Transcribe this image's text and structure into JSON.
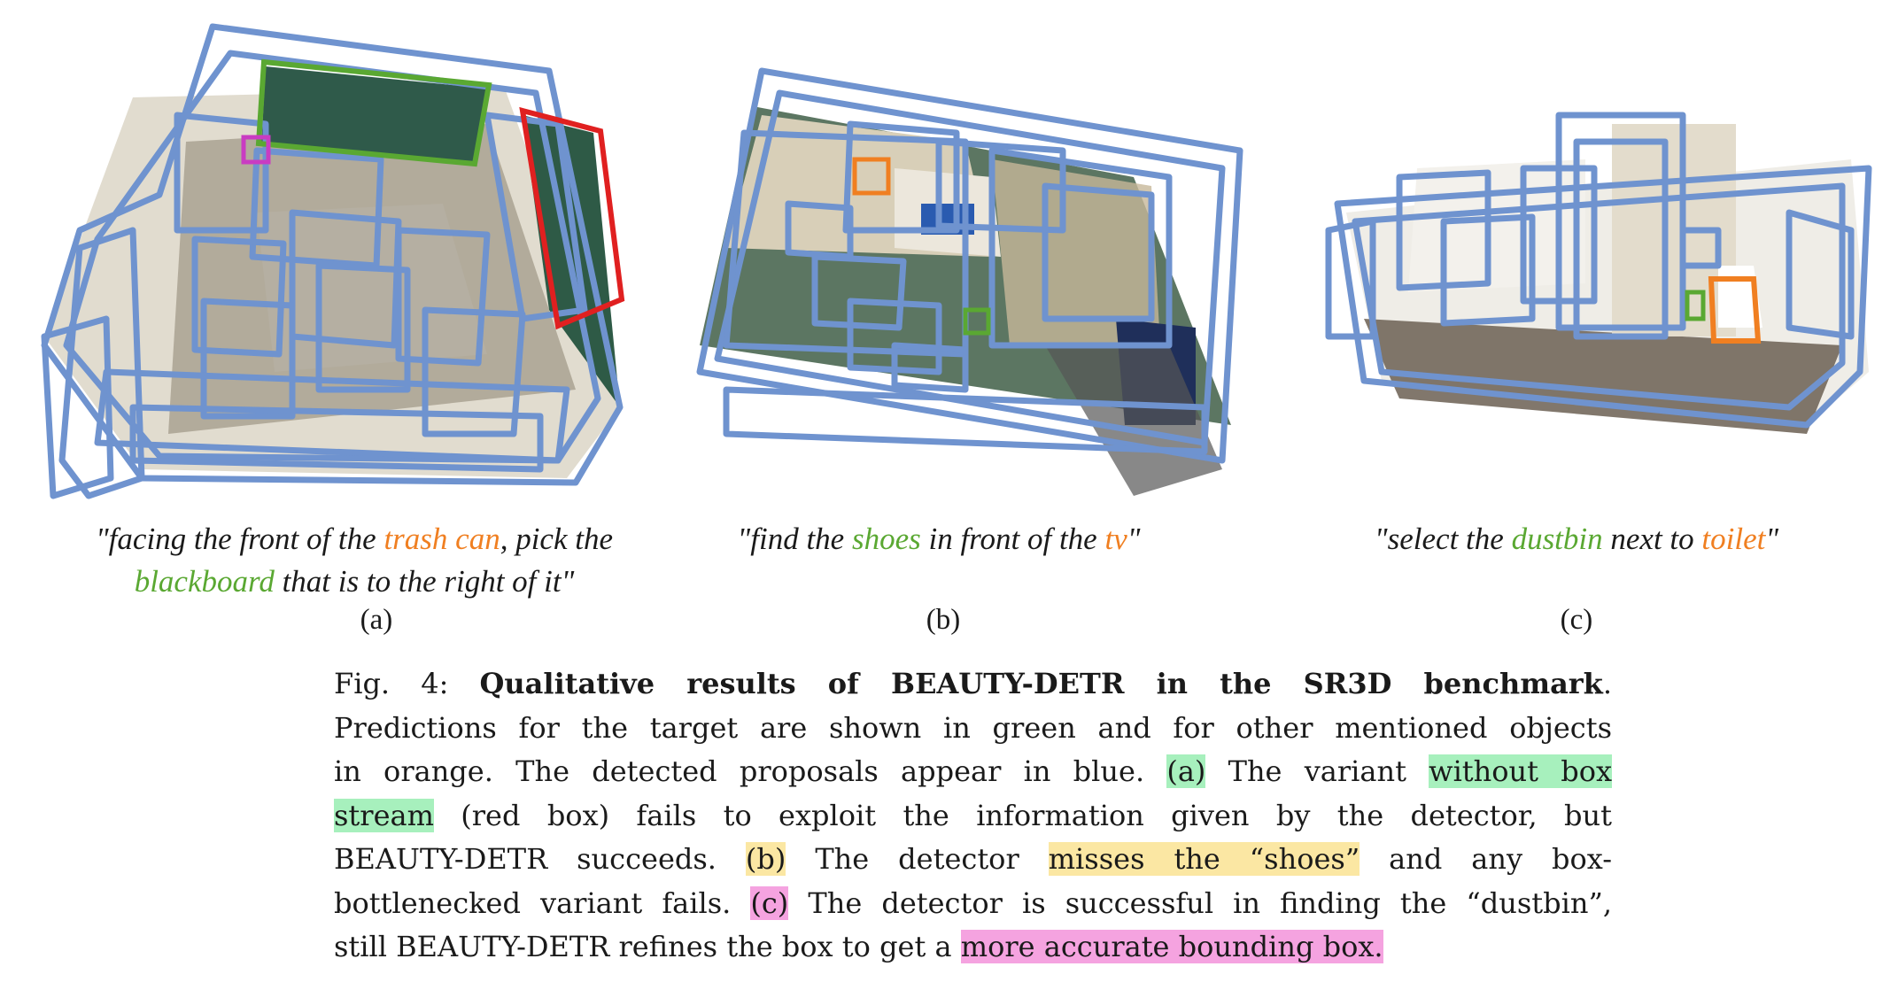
{
  "panels": [
    {
      "label": "(a)",
      "quote": {
        "line1_pre": "\"facing the front of the ",
        "line1_obj": "trash can",
        "line1_post": ", pick the",
        "line2_target": "blackboard",
        "line2_post": " that is to the right of it\""
      }
    },
    {
      "label": "(b)",
      "quote": {
        "pre": "\"find the ",
        "target": "shoes",
        "mid": " in front of the ",
        "obj": "tv",
        "post": "\""
      }
    },
    {
      "label": "(c)",
      "quote": {
        "pre": "\"select the ",
        "target": "dustbin",
        "mid": " next to ",
        "obj": "toilet",
        "post": "\""
      }
    }
  ],
  "caption": {
    "fig": "Fig. 4: ",
    "title": "Qualitative results of BEAUTY-DETR in the SR3D benchmark",
    "title_end": ".",
    "l2": "Predictions for the target are shown in green and for other mentioned objects",
    "l3_a": "in orange. The detected proposals appear in blue. ",
    "l3_hl_a": "(a)",
    "l3_b": " The variant ",
    "l3_hl_b": "without box",
    "l4_hl": "stream",
    "l4_b": " (red box) fails to exploit the information given by the detector, but",
    "l5_a": "BEAUTY-DETR succeeds. ",
    "l5_hl_a": "(b)",
    "l5_b": " The detector ",
    "l5_hl_b": "misses the “shoes”",
    "l5_c": " and any box-",
    "l6_a": "bottlenecked variant fails. ",
    "l6_hl": "(c)",
    "l6_b": " The detector is successful in finding the “dustbin”,",
    "l7_a": "still BEAUTY-DETR refines the box to get a ",
    "l7_hl": "more accurate bounding box."
  },
  "colors": {
    "proposal_blue": "#6f93cf",
    "target_green": "#5aa832",
    "other_orange": "#f07f21",
    "failure_red": "#e02020"
  }
}
